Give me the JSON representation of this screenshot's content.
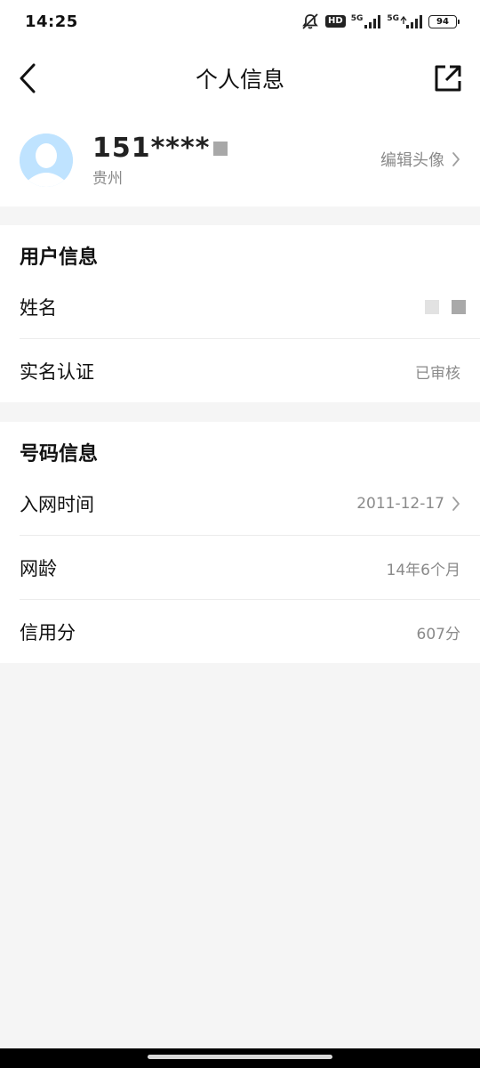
{
  "status_bar": {
    "time": "14:25",
    "hd_label": "HD",
    "net1_label": "5G",
    "net2_label": "5G",
    "battery": "94"
  },
  "header": {
    "title": "个人信息",
    "back_icon": "chevron-left-icon",
    "share_icon": "external-link-icon"
  },
  "profile": {
    "phone": "151****",
    "region": "贵州",
    "edit_label": "编辑头像"
  },
  "user_section": {
    "title": "用户信息",
    "rows": [
      {
        "label": "姓名",
        "value": ""
      },
      {
        "label": "实名认证",
        "value": "已审核"
      }
    ]
  },
  "number_section": {
    "title": "号码信息",
    "rows": [
      {
        "label": "入网时间",
        "value": "2011-12-17"
      },
      {
        "label": "网龄",
        "value": "14年6个月"
      },
      {
        "label": "信用分",
        "value": "607分"
      }
    ]
  },
  "colors": {
    "background": "#f5f5f5",
    "card": "#ffffff",
    "secondary_text": "#8a8a8a",
    "avatar": "#bfe3ff"
  }
}
